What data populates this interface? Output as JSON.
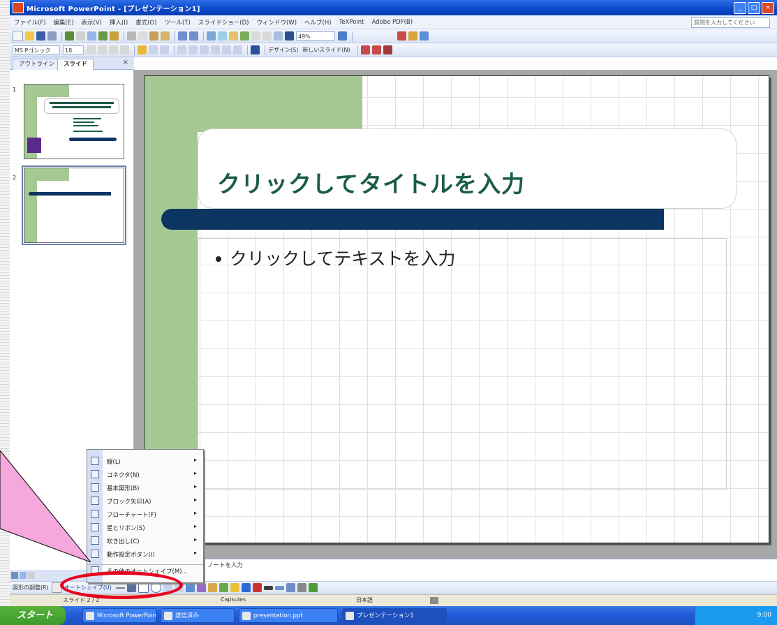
{
  "window": {
    "title": "Microsoft PowerPoint - [プレゼンテーション1]",
    "controls": [
      "_",
      "□",
      "×"
    ]
  },
  "menu": {
    "items": [
      "ファイル(F)",
      "編集(E)",
      "表示(V)",
      "挿入(I)",
      "書式(O)",
      "ツール(T)",
      "スライドショー(D)",
      "ウィンドウ(W)",
      "ヘルプ(H)",
      "TeXPoint",
      "Adobe PDF(B)"
    ],
    "help_placeholder": "質問を入力してください"
  },
  "toolbar": {
    "zoom": "49%",
    "font_name": "MS Pゴシック",
    "font_size": "18",
    "design_label": "デザイン(S)",
    "new_slide_label": "新しいスライド(N)"
  },
  "pane": {
    "tab_outline": "アウトライン",
    "tab_slides": "スライド",
    "close": "×",
    "slide1_num": "1",
    "slide2_num": "2"
  },
  "slide": {
    "title_placeholder": "クリックしてタイトルを入力",
    "body_placeholder": "クリックしてテキストを入力"
  },
  "notes": {
    "text": "ノートを入力"
  },
  "draw_toolbar": {
    "draw_label": "図形の調整(R)",
    "autoshape_label": "オートシェイプ(U)"
  },
  "status": {
    "slide_count": "スライド 2 / 2",
    "template": "Capsules",
    "language": "日本語"
  },
  "popup_menu": {
    "items": [
      {
        "label": "線(L)",
        "icon": "line-icon"
      },
      {
        "label": "コネクタ(N)",
        "icon": "connector-icon"
      },
      {
        "label": "基本図形(B)",
        "icon": "basic-shapes-icon"
      },
      {
        "label": "ブロック矢印(A)",
        "icon": "block-arrow-icon"
      },
      {
        "label": "フローチャート(F)",
        "icon": "flowchart-icon"
      },
      {
        "label": "星とリボン(S)",
        "icon": "star-ribbon-icon"
      },
      {
        "label": "吹き出し(C)",
        "icon": "callout-icon"
      },
      {
        "label": "動作設定ボタン(I)",
        "icon": "action-button-icon"
      },
      {
        "label": "その他のオートシェイプ(M)...",
        "icon": "more-shapes-icon"
      }
    ]
  },
  "taskbar": {
    "start_label": "スタート",
    "tasks": [
      "Microsoft PowerPoint",
      "送信済み",
      "presentation.ppt",
      "プレゼンテーション1"
    ],
    "clock": "9:00"
  },
  "colors": {
    "slide_green": "#a6c994",
    "slide_dark_bar": "#0d3562",
    "title_text": "#1b5c46",
    "highlight_ring": "#e6001e",
    "callout_fill": "#f6a7dc"
  }
}
